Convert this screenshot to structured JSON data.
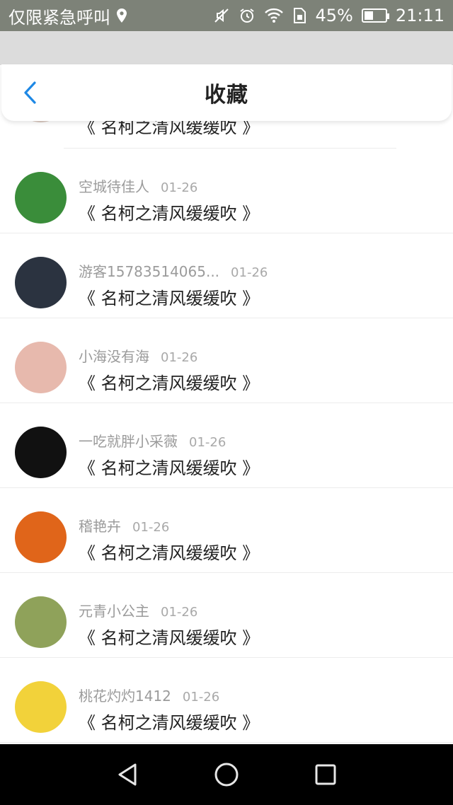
{
  "status_bar": {
    "carrier": "仅限紧急呼叫",
    "battery_percent": "45%",
    "battery_level": 0.45,
    "time": "21:11"
  },
  "header": {
    "title": "收藏"
  },
  "partial_item": {
    "title": "《 名柯之清风缓缓吹 》"
  },
  "list": [
    {
      "name": "空城待佳人",
      "date": "01-26",
      "title": "《 名柯之清风缓缓吹 》",
      "avatar_color": "#3a8d3a"
    },
    {
      "name": "游客15783514065...",
      "date": "01-26",
      "title": "《 名柯之清风缓缓吹 》",
      "avatar_color": "#2b3340"
    },
    {
      "name": "小海没有海",
      "date": "01-26",
      "title": "《 名柯之清风缓缓吹 》",
      "avatar_color": "#e7b9ad"
    },
    {
      "name": "一吃就胖小采薇",
      "date": "01-26",
      "title": "《 名柯之清风缓缓吹 》",
      "avatar_color": "#111111"
    },
    {
      "name": "稽艳卉",
      "date": "01-26",
      "title": "《 名柯之清风缓缓吹 》",
      "avatar_color": "#e0651a"
    },
    {
      "name": "元青小公主",
      "date": "01-26",
      "title": "《 名柯之清风缓缓吹 》",
      "avatar_color": "#8fa25a"
    },
    {
      "name": "桃花灼灼1412",
      "date": "01-26",
      "title": "《 名柯之清风缓缓吹 》",
      "avatar_color": "#f2d23a"
    }
  ],
  "colors": {
    "accent": "#1e88e5",
    "status_bar_bg": "#7d8278",
    "nav_bar_bg": "#000000"
  },
  "icons": {
    "back": "chevron-left-icon",
    "location": "location-pin-icon",
    "mute": "vibrate-mute-icon",
    "alarm": "alarm-clock-icon",
    "wifi": "wifi-icon",
    "sim": "sim-card-icon",
    "battery": "battery-icon",
    "nav_back": "triangle-back-icon",
    "nav_home": "circle-home-icon",
    "nav_recents": "square-recents-icon"
  }
}
